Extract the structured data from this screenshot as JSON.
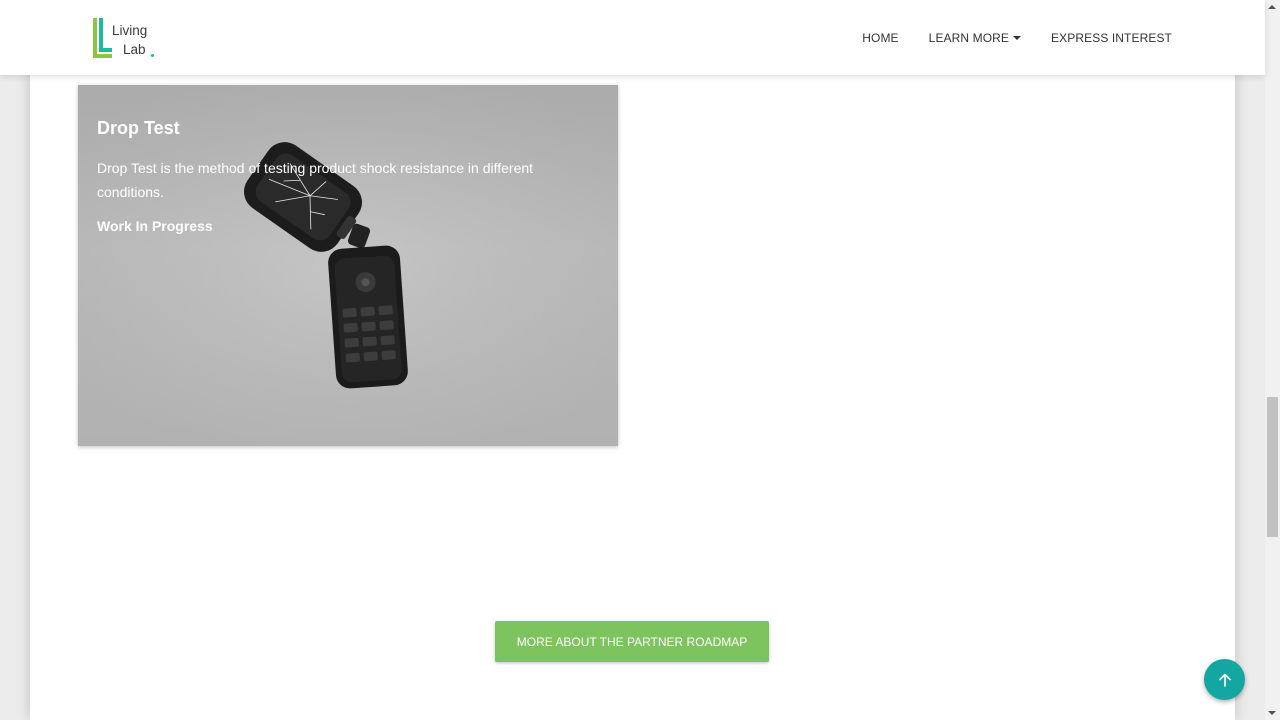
{
  "brand": {
    "logo_line1": "Living",
    "logo_line2": "Lab",
    "accent": "#1abc9c"
  },
  "nav": {
    "home": "HOME",
    "learn_more": "LEARN MORE",
    "express_interest": "EXPRESS INTEREST"
  },
  "card": {
    "title": "Drop Test",
    "description": "Drop Test is the method of testing product shock resistance in different conditions.",
    "status": "Work In Progress",
    "image_icon": "broken-flip-phone"
  },
  "cta": {
    "label": "MORE ABOUT THE PARTNER ROADMAP",
    "color": "#7ec45e"
  },
  "back_to_top": {
    "icon": "arrow-up-icon",
    "color": "#14a7a2"
  }
}
